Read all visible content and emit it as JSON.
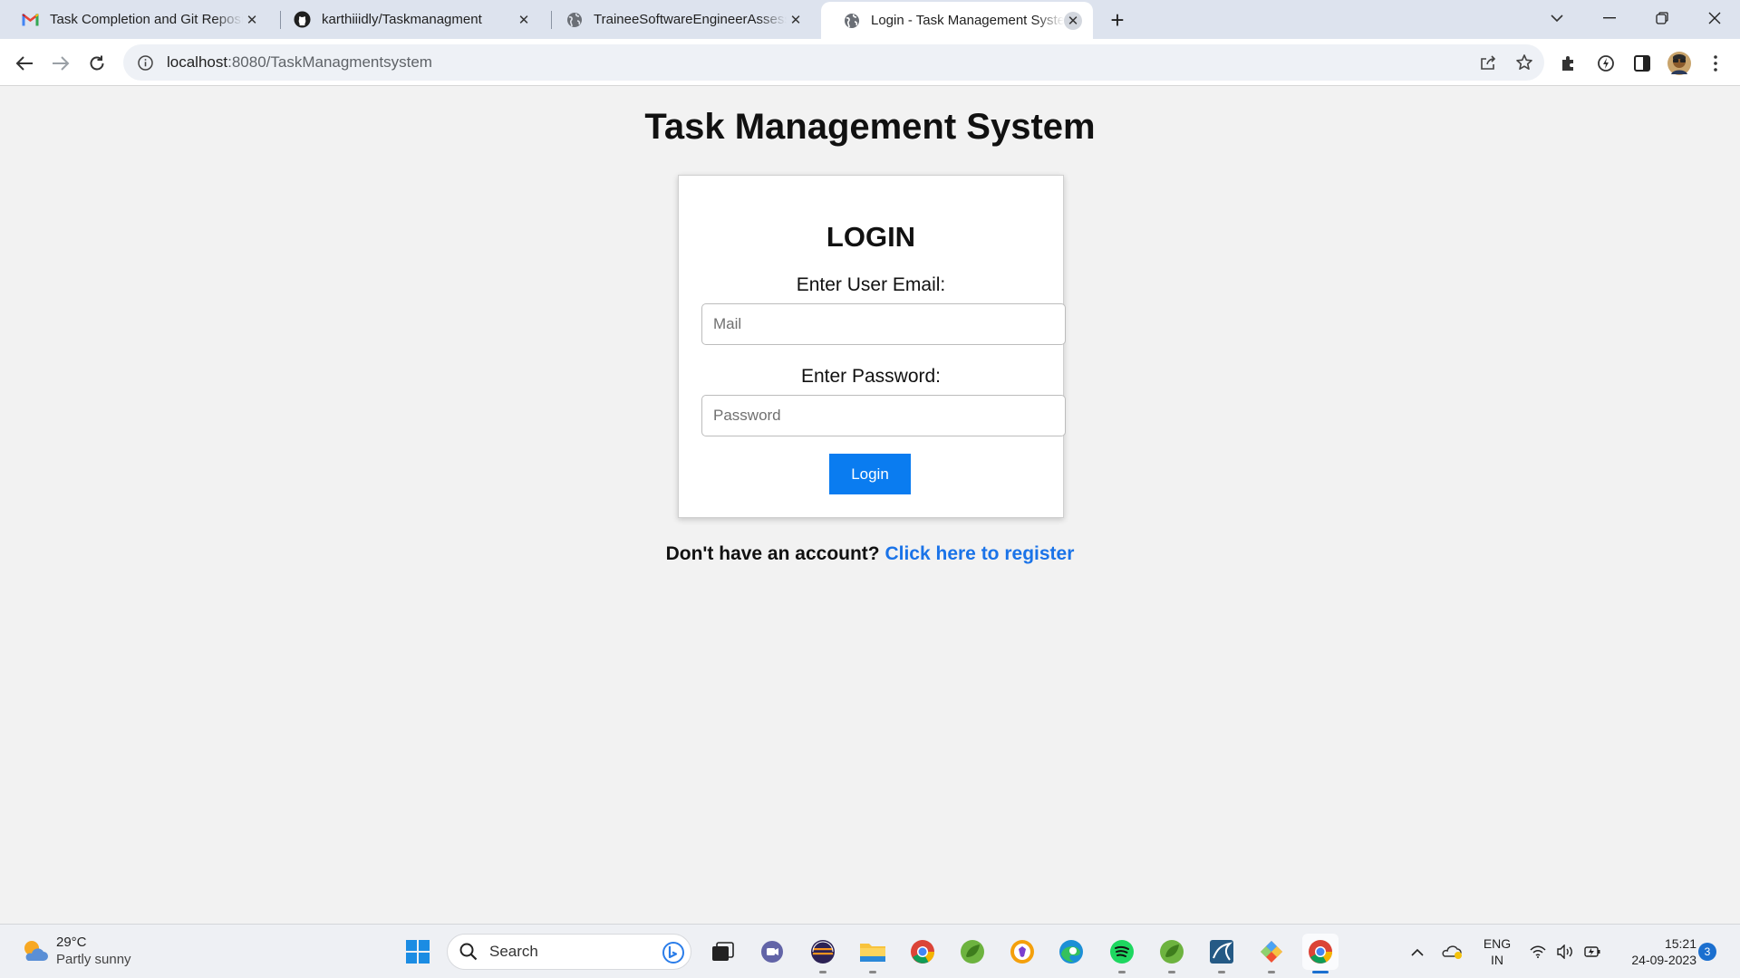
{
  "browser": {
    "tabs": [
      {
        "title": "Task Completion and Git Repository",
        "icon": "gmail-icon"
      },
      {
        "title": "karthiiidly/Taskmanagment",
        "icon": "github-icon"
      },
      {
        "title": "TraineeSoftwareEngineerAssessment",
        "icon": "globe-icon"
      },
      {
        "title": "Login - Task Management System",
        "icon": "globe-icon",
        "active": true
      }
    ],
    "new_tab_symbol": "+",
    "address": {
      "host": "localhost",
      "path": ":8080/TaskManagmentsystem"
    }
  },
  "page": {
    "title": "Task Management System",
    "card": {
      "heading": "LOGIN",
      "email_label": "Enter User Email:",
      "email_placeholder": "Mail",
      "password_label": "Enter Password:",
      "password_placeholder": "Password",
      "login_button": "Login"
    },
    "register_prompt": "Don't have an account?",
    "register_link": "Click here to register"
  },
  "taskbar": {
    "weather": {
      "temp": "29°C",
      "condition": "Partly sunny"
    },
    "search_placeholder": "Search",
    "language": {
      "line1": "ENG",
      "line2": "IN"
    },
    "time": "15:21",
    "date": "24-09-2023",
    "notifications": "3"
  },
  "colors": {
    "accent": "#0a7cf0",
    "link": "#1a73e8",
    "tabstrip": "#dde3ee"
  }
}
